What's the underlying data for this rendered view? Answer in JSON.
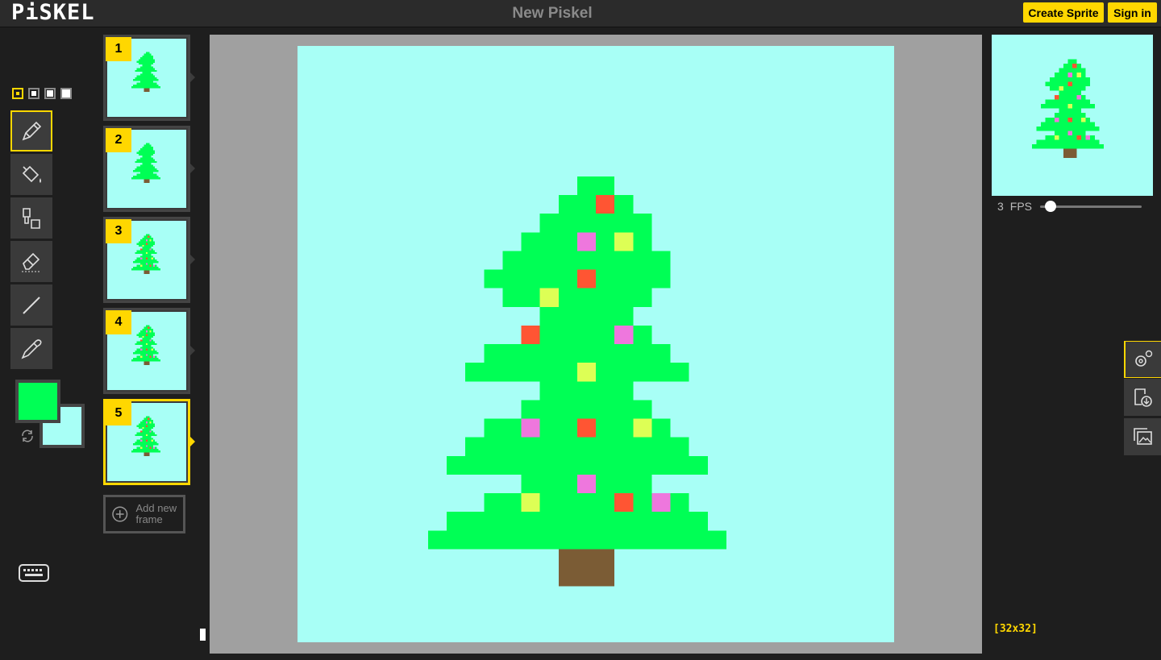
{
  "app": {
    "logo": "PiSKEL",
    "title": "New Piskel"
  },
  "header": {
    "create_sprite_label": "Create Sprite",
    "sign_in_label": "Sign in"
  },
  "tools": {
    "pen_sizes": [
      1,
      2,
      3,
      4
    ],
    "selected_pen_size": 1,
    "items": [
      {
        "name": "pen-tool",
        "icon": "pencil-icon",
        "selected": true
      },
      {
        "name": "paint-bucket-tool",
        "icon": "paint-bucket-icon",
        "selected": false
      },
      {
        "name": "paint-same-pixels-tool",
        "icon": "brush-bucket-icon",
        "selected": false
      },
      {
        "name": "eraser-tool",
        "icon": "eraser-icon",
        "selected": false
      },
      {
        "name": "stroke-tool",
        "icon": "line-icon",
        "selected": false
      },
      {
        "name": "color-picker-tool",
        "icon": "eyedropper-icon",
        "selected": false
      }
    ],
    "primary_color": "#00ff55",
    "secondary_color": "#a8fff6"
  },
  "frames": {
    "items": [
      {
        "number": "1",
        "selected": false
      },
      {
        "number": "2",
        "selected": false
      },
      {
        "number": "3",
        "selected": false
      },
      {
        "number": "4",
        "selected": false
      },
      {
        "number": "5",
        "selected": true
      }
    ],
    "add_frame_label": "Add new frame"
  },
  "preview": {
    "fps_value": "3",
    "fps_label": "FPS",
    "fps_slider_fraction": 0.05
  },
  "canvas": {
    "size_label": "[32x32]",
    "background": "#a8fff6",
    "tree_color": "#00ff55",
    "trunk_color": "#7b5c35",
    "ornament_red": "#ff5533",
    "ornament_pink": "#ee77dd",
    "ornament_yellow": "#ddff55"
  },
  "side_panel": {
    "buttons": [
      {
        "name": "settings-button",
        "icon": "settings-gear-icon",
        "selected": true
      },
      {
        "name": "export-button",
        "icon": "export-image-icon",
        "selected": false
      },
      {
        "name": "import-button",
        "icon": "import-images-icon",
        "selected": false
      }
    ]
  }
}
